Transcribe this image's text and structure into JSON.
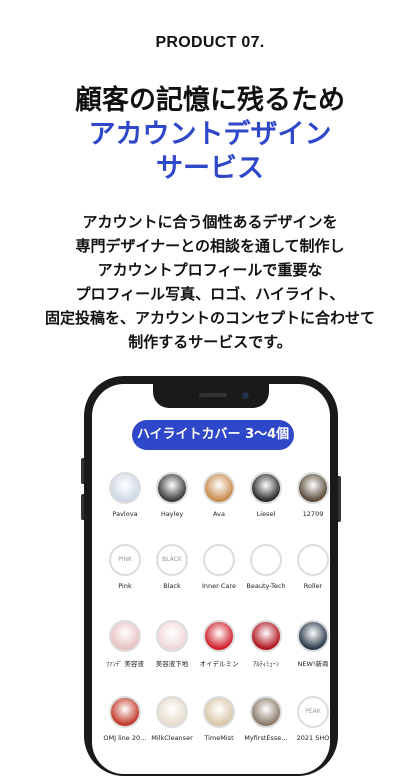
{
  "product_label": "PRODUCT 07.",
  "headline": {
    "line1": "顧客の記憶に残るため",
    "line2": "アカウントデザイン",
    "line3": "サービス"
  },
  "description": [
    "アカウントに合う個性あるデザインを",
    "専門デザイナーとの相談を通して制作し",
    "アカウントプロフィールで重要な",
    "プロフィール写真、ロゴ、ハイライト、",
    "固定投稿を、アカウントのコンセプトに合わせて",
    "制作するサービスです。"
  ],
  "phone": {
    "badge": "ハイライトカバー 3〜4個",
    "rows": [
      [
        {
          "label": "Pavlova",
          "icon": "dress-icon",
          "color": "#cfd8e6"
        },
        {
          "label": "Hayley",
          "icon": "dress-icon",
          "color": "#3a3a3a"
        },
        {
          "label": "Ava",
          "icon": "dress-icon",
          "color": "#c88a4a"
        },
        {
          "label": "Liesel",
          "icon": "dress-icon",
          "color": "#2a2a2a"
        },
        {
          "label": "12709",
          "icon": "venue-icon",
          "color": "#5a4a3a"
        }
      ],
      [
        {
          "label": "Pink",
          "icon": "text-circle-icon",
          "text": "PINK"
        },
        {
          "label": "Black",
          "icon": "text-circle-icon",
          "text": "BLACK"
        },
        {
          "label": "Inner Care",
          "icon": "bottle-icon",
          "color": "#ffffff"
        },
        {
          "label": "Beauty-Tech",
          "icon": "device-icon",
          "color": "#ffffff"
        },
        {
          "label": "Roller",
          "icon": "roller-icon",
          "color": "#ffffff"
        }
      ],
      [
        {
          "label": "ﾌｧﾝﾃﾞ 美容液",
          "icon": "cosmetic-icon",
          "color": "#e8c2c2"
        },
        {
          "label": "美容液下地",
          "icon": "cosmetic-icon",
          "color": "#f2d9d9"
        },
        {
          "label": "オイデルミン",
          "icon": "bottle-icon",
          "color": "#d11f2a"
        },
        {
          "label": "ｱﾙﾃｨﾐｭｰﾝ",
          "icon": "bottle-icon",
          "color": "#b0141e"
        },
        {
          "label": "NEW!新商",
          "icon": "product-icon",
          "color": "#2a3a4a"
        }
      ],
      [
        {
          "label": "OMJ line 20…",
          "icon": "hands-icon",
          "color": "#c23a2a"
        },
        {
          "label": "MilkCleanser",
          "icon": "bottle-icon",
          "color": "#e6dccd"
        },
        {
          "label": "TimeMist",
          "icon": "bottle-icon",
          "color": "#d9c8a8"
        },
        {
          "label": "MyfirstEsse…",
          "icon": "portrait-icon",
          "color": "#8a7a6a"
        },
        {
          "label": "2021 SHO",
          "icon": "text-circle-icon",
          "text": "PEAK"
        }
      ]
    ]
  }
}
